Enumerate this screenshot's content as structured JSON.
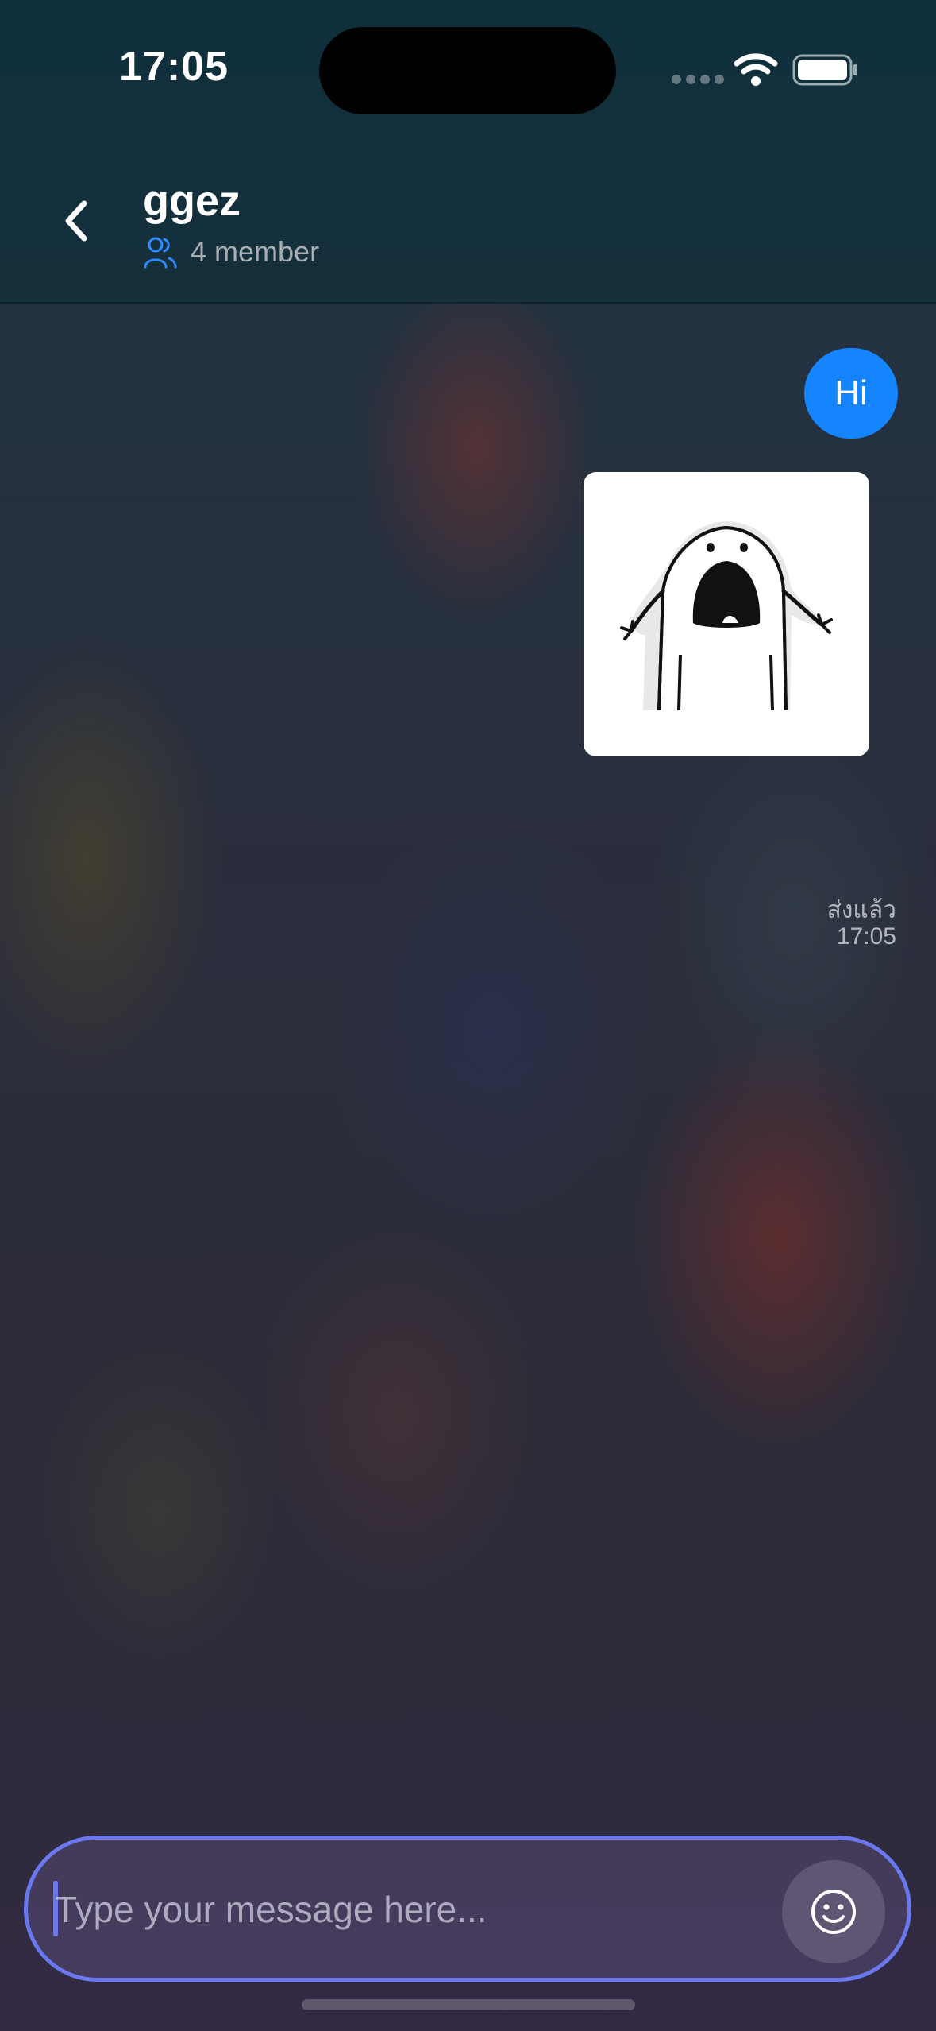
{
  "status_bar": {
    "time": "17:05",
    "icons": [
      "signal-icon",
      "wifi-icon",
      "battery-icon"
    ]
  },
  "header": {
    "title": "ggez",
    "members": "4 member",
    "icons": [
      "back-chevron-icon",
      "members-icon"
    ]
  },
  "messages": [
    {
      "type": "text",
      "text": "Hi",
      "color": "#1485ff"
    },
    {
      "type": "sticker",
      "icon": "screaming-ghost-sticker"
    }
  ],
  "receipt": {
    "status": "ส่งแล้ว",
    "time": "17:05"
  },
  "composer": {
    "placeholder": "Type your message here...",
    "value": "",
    "emoji_icon": "smiley-icon",
    "accent": "#6a78f0"
  }
}
